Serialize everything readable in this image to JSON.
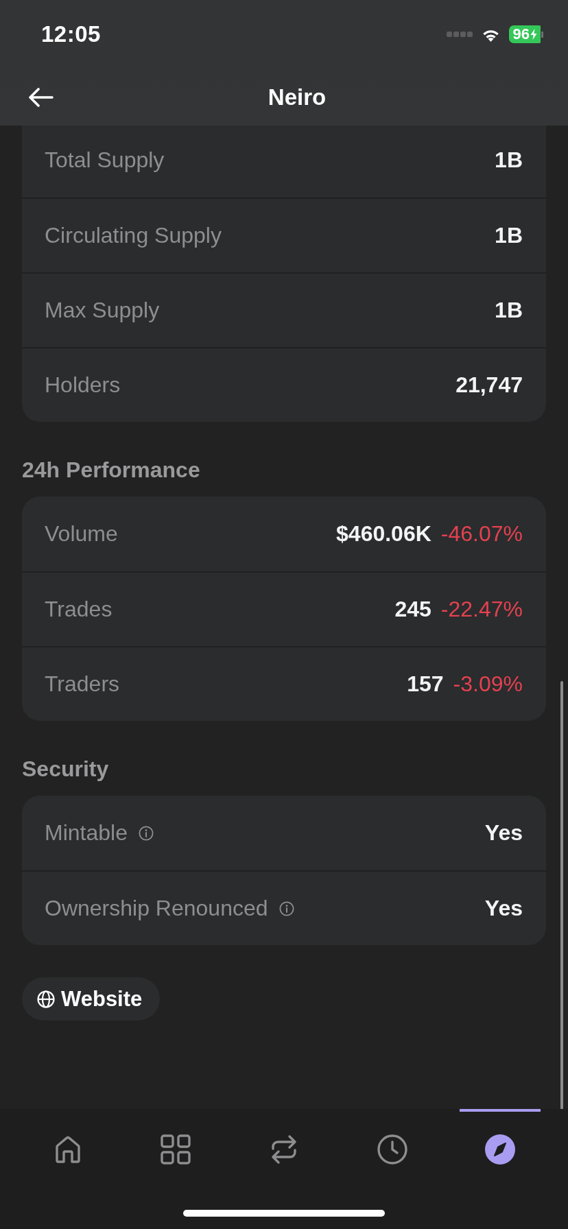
{
  "status_bar": {
    "time": "12:05",
    "battery": {
      "text": "96",
      "charging": true
    }
  },
  "header": {
    "title": "Neiro"
  },
  "supply": {
    "rows": [
      {
        "label": "Total Supply",
        "value": "1B"
      },
      {
        "label": "Circulating Supply",
        "value": "1B"
      },
      {
        "label": "Max Supply",
        "value": "1B"
      },
      {
        "label": "Holders",
        "value": "21,747"
      }
    ]
  },
  "performance": {
    "title": "24h Performance",
    "rows": [
      {
        "label": "Volume",
        "value": "$460.06K",
        "change": "-46.07%",
        "negative": true
      },
      {
        "label": "Trades",
        "value": "245",
        "change": "-22.47%",
        "negative": true
      },
      {
        "label": "Traders",
        "value": "157",
        "change": "-3.09%",
        "negative": true
      }
    ]
  },
  "security": {
    "title": "Security",
    "rows": [
      {
        "label": "Mintable",
        "info": true,
        "value": "Yes"
      },
      {
        "label": "Ownership Renounced",
        "info": true,
        "value": "Yes"
      }
    ]
  },
  "links": [
    {
      "label": "Website"
    }
  ],
  "nav": {
    "tabs": [
      {
        "selected": false
      },
      {
        "selected": false
      },
      {
        "selected": false
      },
      {
        "selected": false
      },
      {
        "selected": true
      }
    ]
  }
}
